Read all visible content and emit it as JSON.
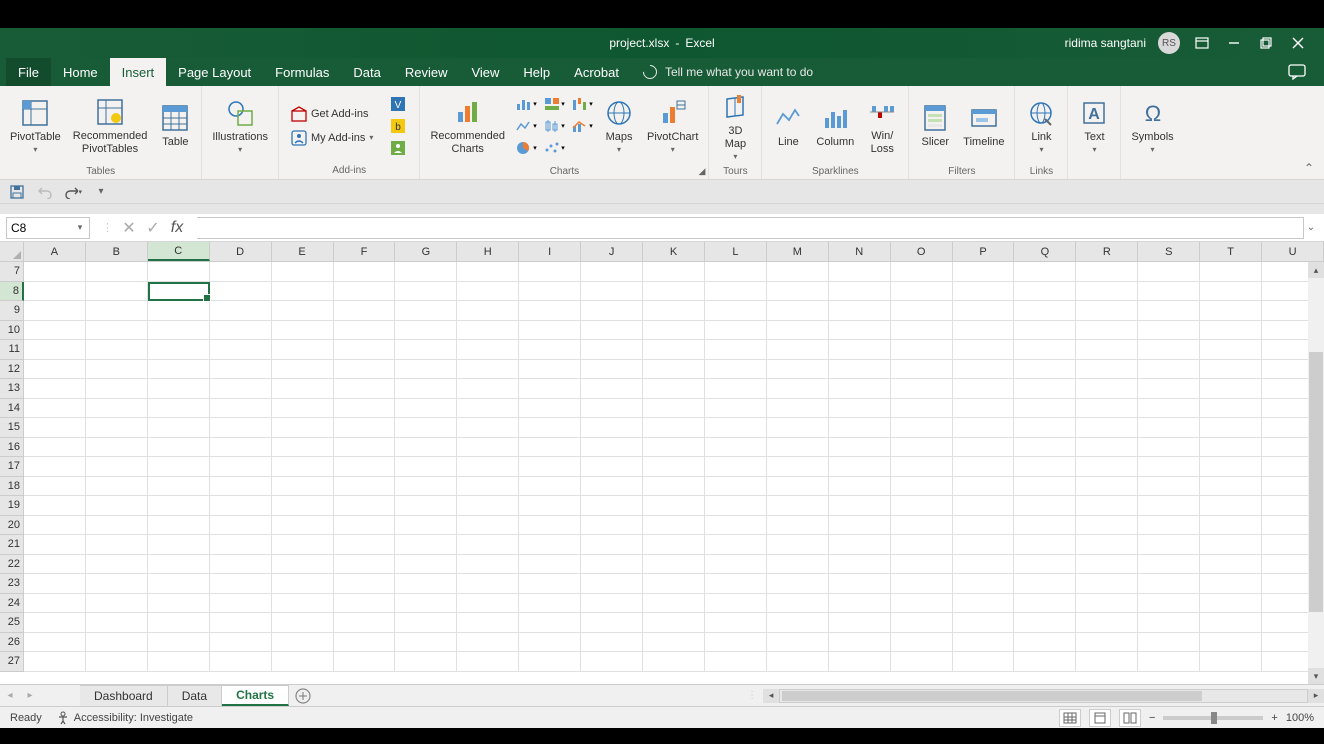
{
  "title": {
    "filename": "project.xlsx",
    "app": "Excel"
  },
  "user": {
    "name": "ridima sangtani",
    "initials": "RS"
  },
  "tabs": {
    "file": "File",
    "home": "Home",
    "insert": "Insert",
    "pagelayout": "Page Layout",
    "formulas": "Formulas",
    "data": "Data",
    "review": "Review",
    "view": "View",
    "help": "Help",
    "acrobat": "Acrobat",
    "tellme": "Tell me what you want to do"
  },
  "ribbon": {
    "tables": {
      "label": "Tables",
      "pivot": "PivotTable",
      "recpivot": "Recommended\nPivotTables",
      "table": "Table"
    },
    "illustrations": {
      "label": "",
      "btn": "Illustrations"
    },
    "addins": {
      "label": "Add-ins",
      "get": "Get Add-ins",
      "my": "My Add-ins"
    },
    "charts": {
      "label": "Charts",
      "rec": "Recommended\nCharts",
      "maps": "Maps",
      "pivotchart": "PivotChart"
    },
    "tours": {
      "label": "Tours",
      "map3d": "3D\nMap"
    },
    "sparklines": {
      "label": "Sparklines",
      "line": "Line",
      "column": "Column",
      "winloss": "Win/\nLoss"
    },
    "filters": {
      "label": "Filters",
      "slicer": "Slicer",
      "timeline": "Timeline"
    },
    "links": {
      "label": "Links",
      "link": "Link"
    },
    "text": {
      "label": "",
      "btn": "Text"
    },
    "symbols": {
      "label": "",
      "btn": "Symbols"
    }
  },
  "namebox": "C8",
  "columns": [
    "A",
    "B",
    "C",
    "D",
    "E",
    "F",
    "G",
    "H",
    "I",
    "J",
    "K",
    "L",
    "M",
    "N",
    "O",
    "P",
    "Q",
    "R",
    "S",
    "T",
    "U"
  ],
  "rows": [
    7,
    8,
    9,
    10,
    11,
    12,
    13,
    14,
    15,
    16,
    17,
    18,
    19,
    20,
    21,
    22,
    23,
    24,
    25,
    26,
    27
  ],
  "active": {
    "col": "C",
    "row": 8
  },
  "sheets": {
    "s1": "Dashboard",
    "s2": "Data",
    "s3": "Charts"
  },
  "status": {
    "ready": "Ready",
    "accessibility": "Accessibility: Investigate",
    "zoom": "100%"
  }
}
